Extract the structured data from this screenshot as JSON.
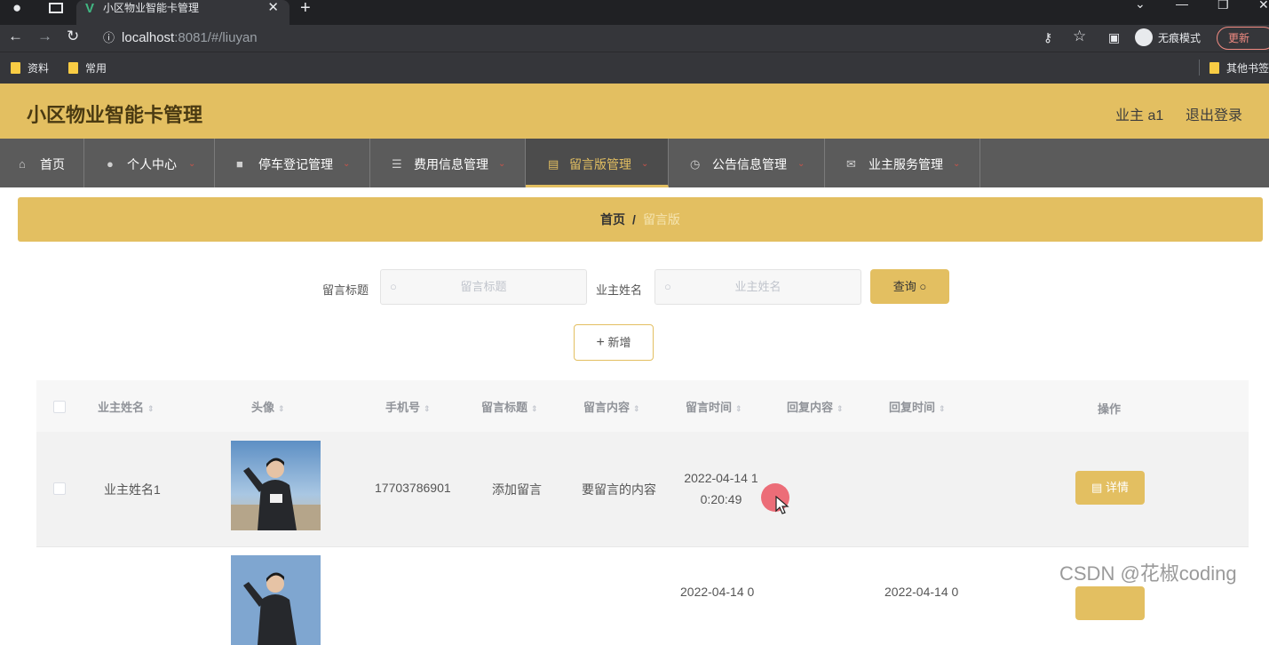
{
  "browser": {
    "tab_title": "小区物业智能卡管理",
    "url_host": "localhost",
    "url_path": ":8081/#/liuyan",
    "incognito_label": "无痕模式",
    "update_label": "更新",
    "bookmarks": [
      "资料",
      "常用"
    ],
    "other_bookmarks": "其他书签"
  },
  "header": {
    "title": "小区物业智能卡管理",
    "user": "业主 a1",
    "logout": "退出登录"
  },
  "nav": [
    {
      "label": "首页",
      "icon": "home-icon"
    },
    {
      "label": "个人中心",
      "icon": "user-icon"
    },
    {
      "label": "停车登记管理",
      "icon": "briefcase-icon"
    },
    {
      "label": "费用信息管理",
      "icon": "list-icon"
    },
    {
      "label": "留言版管理",
      "icon": "clipboard-icon"
    },
    {
      "label": "公告信息管理",
      "icon": "clock-icon"
    },
    {
      "label": "业主服务管理",
      "icon": "mail-icon"
    }
  ],
  "breadcrumb": {
    "home": "首页",
    "separator": "/",
    "current": "留言版"
  },
  "search": {
    "title_label": "留言标题",
    "title_placeholder": "留言标题",
    "name_label": "业主姓名",
    "name_placeholder": "业主姓名",
    "query_button": "查询",
    "add_button": "新增"
  },
  "table": {
    "columns": [
      "业主姓名",
      "头像",
      "手机号",
      "留言标题",
      "留言内容",
      "留言时间",
      "回复内容",
      "回复时间",
      "操作"
    ],
    "rows": [
      {
        "name": "业主姓名1",
        "phone": "17703786901",
        "title": "添加留言",
        "content": "要留言的内容",
        "time_line1": "2022-04-14 1",
        "time_line2": "0:20:49",
        "reply": "",
        "reply_time": "",
        "action": "详情"
      },
      {
        "time_line1": "2022-04-14 0",
        "reply_time_line1": "2022-04-14 0"
      }
    ]
  },
  "watermark": "CSDN @花椒coding",
  "colors": {
    "accent": "#e3bf61",
    "nav_bg": "#5b5b5b",
    "cursor_highlight": "#ea4856"
  }
}
